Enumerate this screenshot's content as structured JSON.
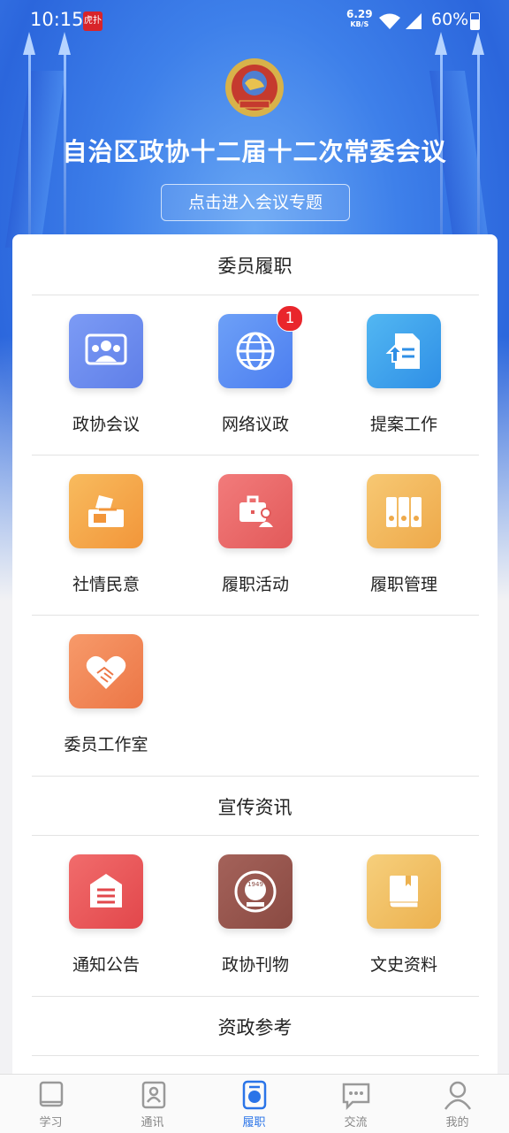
{
  "status_bar": {
    "time": "10:15",
    "notif_app": "虎扑",
    "net_speed": "6.29",
    "net_unit": "KB/S",
    "battery": "60%"
  },
  "banner": {
    "title": "自治区政协十二届十二次常委会议",
    "button": "点击进入会议专题"
  },
  "sections": {
    "duty": {
      "title": "委员履职",
      "items": [
        {
          "label": "政协会议",
          "icon": "meeting-icon",
          "color": "#6f8ff0"
        },
        {
          "label": "网络议政",
          "icon": "globe-icon",
          "color": "#5b8ff2",
          "badge": "1"
        },
        {
          "label": "提案工作",
          "icon": "proposal-icon",
          "color": "#3fa3ec"
        },
        {
          "label": "社情民意",
          "icon": "ballot-box-icon",
          "color": "#f5a64a"
        },
        {
          "label": "履职活动",
          "icon": "briefcase-icon",
          "color": "#ec6b6b"
        },
        {
          "label": "履职管理",
          "icon": "binders-icon",
          "color": "#f2b45e"
        },
        {
          "label": "委员工作室",
          "icon": "handshake-icon",
          "color": "#f18a5a"
        }
      ]
    },
    "publicity": {
      "title": "宣传资讯",
      "items": [
        {
          "label": "通知公告",
          "icon": "notice-icon",
          "color": "#ec5a5c"
        },
        {
          "label": "政协刊物",
          "icon": "emblem-icon",
          "color": "#9b5850"
        },
        {
          "label": "文史资料",
          "icon": "book-icon",
          "color": "#f0c062"
        }
      ]
    },
    "reference": {
      "title": "资政参考"
    }
  },
  "tabs": [
    {
      "label": "学习",
      "icon": "book-tab-icon"
    },
    {
      "label": "通讯",
      "icon": "contacts-tab-icon"
    },
    {
      "label": "履职",
      "icon": "badge-tab-icon",
      "active": true
    },
    {
      "label": "交流",
      "icon": "chat-tab-icon"
    },
    {
      "label": "我的",
      "icon": "user-tab-icon"
    }
  ]
}
